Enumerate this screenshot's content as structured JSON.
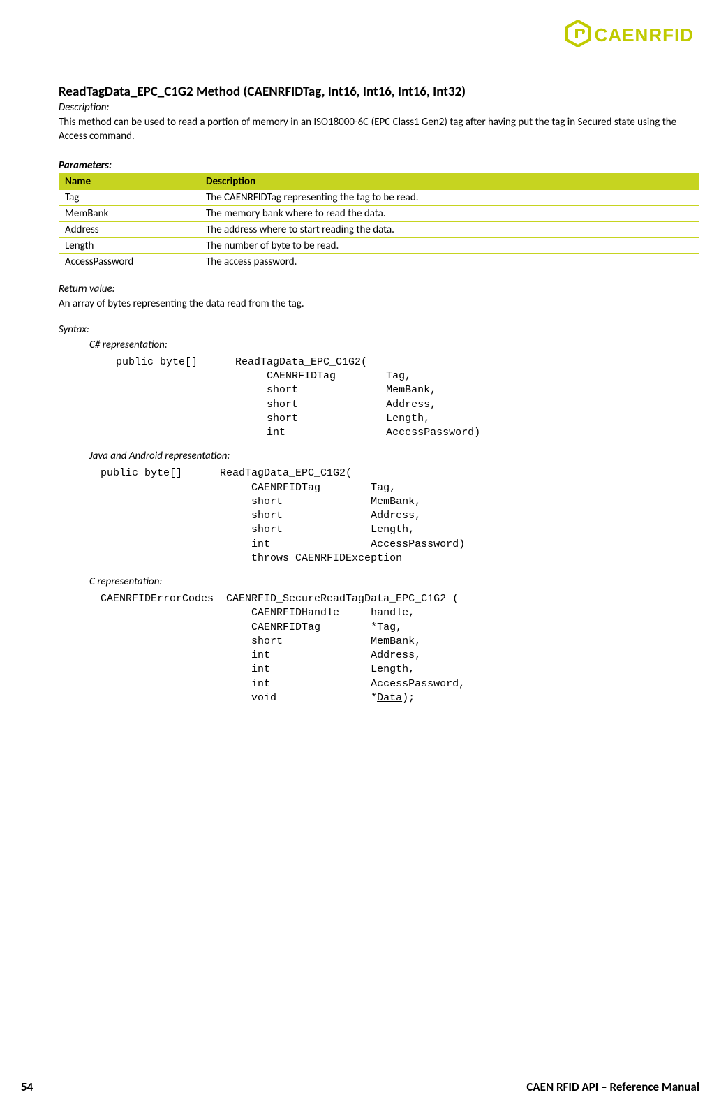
{
  "logo": {
    "text": "CAENRFID"
  },
  "title": "ReadTagData_EPC_C1G2 Method (CAENRFIDTag, Int16, Int16, Int16, Int32)",
  "description_label": "Description:",
  "description_text": "This method can be used to read a portion of memory in an ISO18000-6C (EPC Class1 Gen2) tag after having put the tag in Secured state using the Access command.",
  "parameters_label": "Parameters:",
  "param_table": {
    "headers": {
      "name": "Name",
      "desc": "Description"
    },
    "rows": [
      {
        "name": "Tag",
        "desc": "The CAENRFIDTag representing the tag to be read."
      },
      {
        "name": "MemBank",
        "desc": "The memory bank where to read the data."
      },
      {
        "name": "Address",
        "desc": "The address where to start reading the data."
      },
      {
        "name": "Length",
        "desc": "The number of byte to be read."
      },
      {
        "name": "AccessPassword",
        "desc": "The access password."
      }
    ]
  },
  "return_label": "Return value:",
  "return_text": "An array of bytes representing the data read from the tag.",
  "syntax_label": "Syntax:",
  "csharp_label": "C# representation:",
  "csharp_code": "public byte[]      ReadTagData_EPC_C1G2(\n                        CAENRFIDTag        Tag,\n                        short              MemBank,\n                        short              Address,\n                        short              Length,\n                        int                AccessPassword)",
  "java_label": "Java and Android representation:",
  "java_code": "public byte[]      ReadTagData_EPC_C1G2(\n                        CAENRFIDTag        Tag,\n                        short              MemBank,\n                        short              Address,\n                        short              Length,\n                        int                AccessPassword)\n                        throws CAENRFIDException",
  "c_label": "C representation:",
  "c_code_prefix": "CAENRFIDErrorCodes  CAENRFID_SecureReadTagData_EPC_C1G2 (\n                        CAENRFIDHandle     handle,\n                        CAENRFIDTag        *Tag,\n                        short              MemBank,\n                        int                Address,\n                        int                Length,\n                        int                AccessPassword,\n                        void               *",
  "c_code_data": "Data",
  "c_code_suffix": ");",
  "footer": {
    "page": "54",
    "title": "CAEN RFID API – Reference Manual"
  }
}
